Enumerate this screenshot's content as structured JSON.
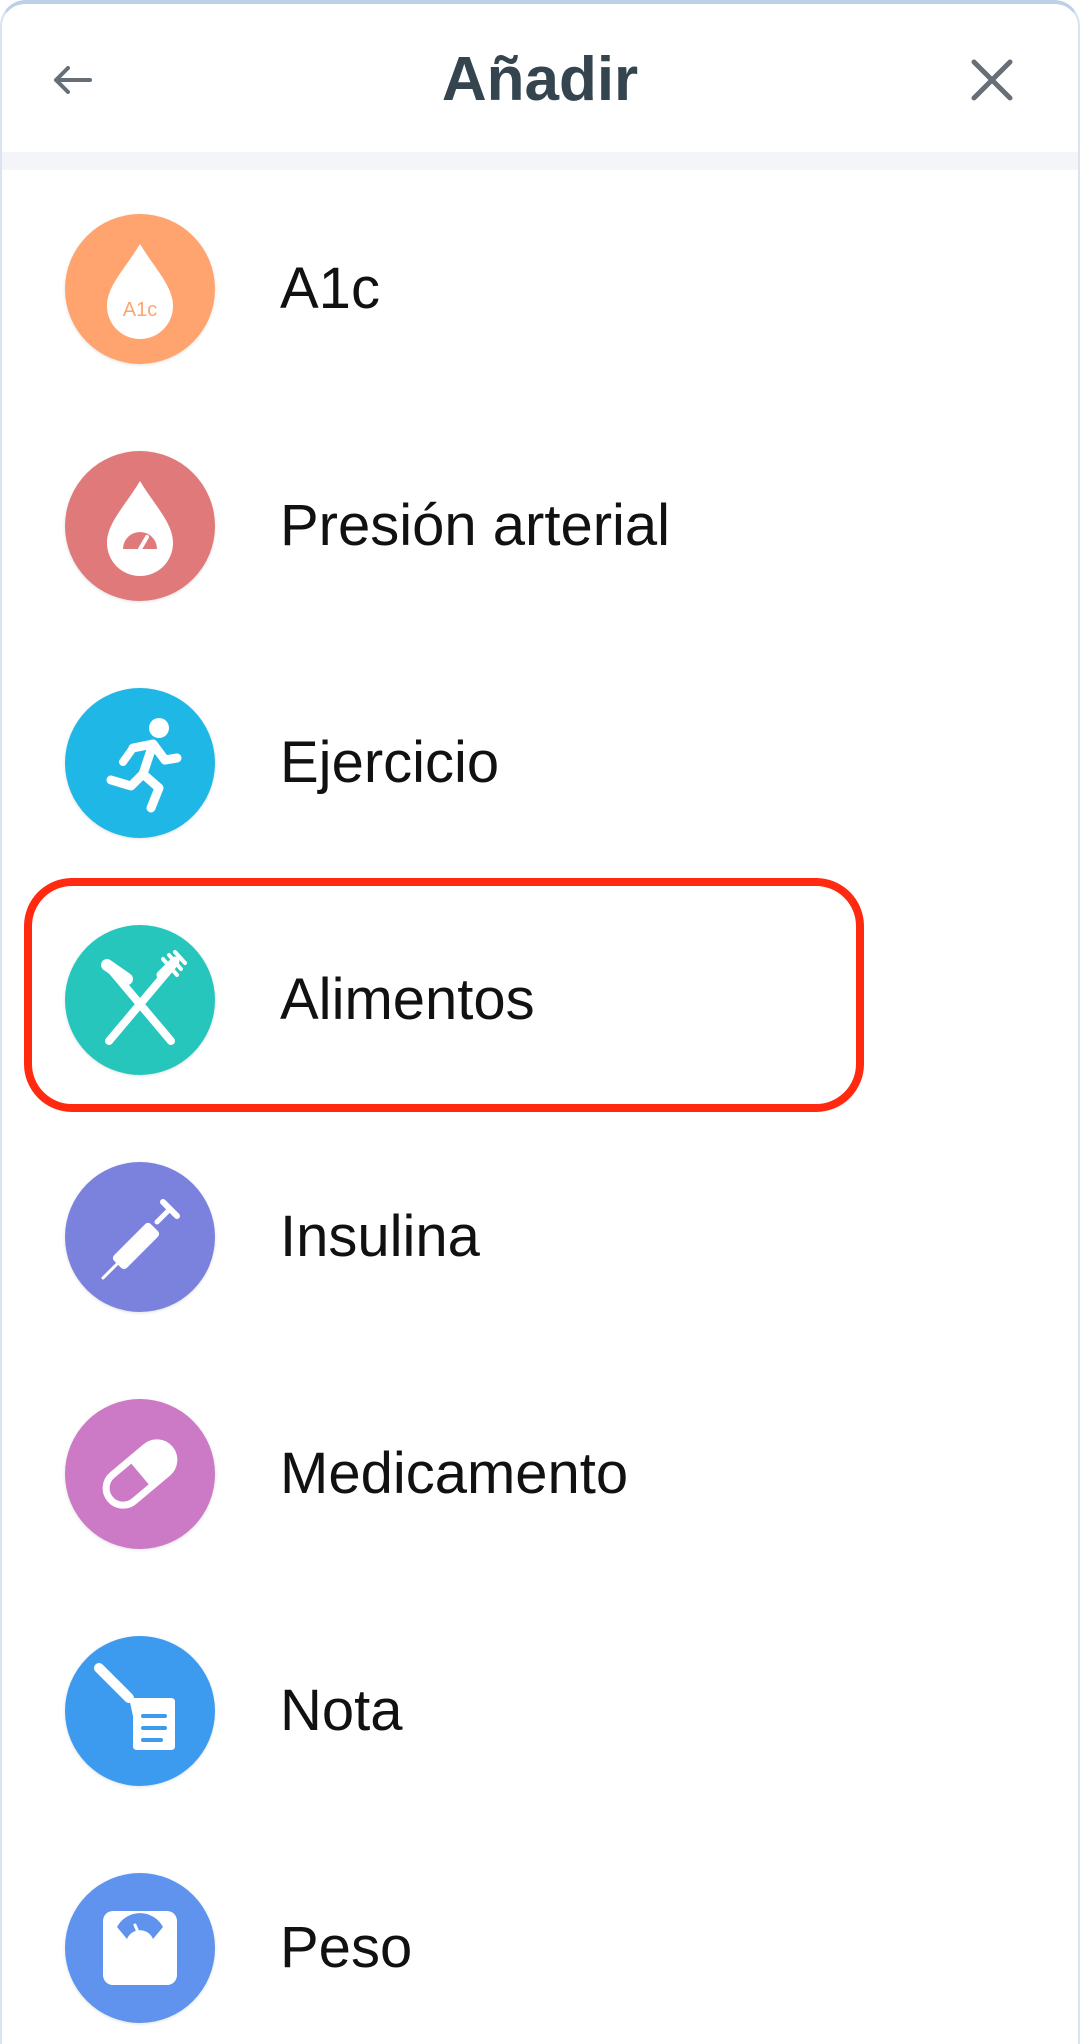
{
  "header": {
    "title": "Añadir",
    "back_icon": "back-arrow-icon",
    "close_icon": "close-icon"
  },
  "items": [
    {
      "label": "A1c",
      "icon": "a1c-drop-icon",
      "icon_text": "A1c",
      "color": "#ffa46f"
    },
    {
      "label": "Presión arterial",
      "icon": "blood-pressure-icon",
      "color": "#e07a7a"
    },
    {
      "label": "Ejercicio",
      "icon": "running-person-icon",
      "color": "#1fb7e6"
    },
    {
      "label": "Alimentos",
      "icon": "fork-knife-icon",
      "color": "#26c6bd"
    },
    {
      "label": "Insulina",
      "icon": "syringe-icon",
      "color": "#7b82de"
    },
    {
      "label": "Medicamento",
      "icon": "pill-icon",
      "color": "#cc79c6"
    },
    {
      "label": "Nota",
      "icon": "note-icon",
      "color": "#3d9bef"
    },
    {
      "label": "Peso",
      "icon": "scale-icon",
      "color": "#5f93ee"
    }
  ],
  "highlighted_item": "Alimentos",
  "highlight_color": "#ff2a10"
}
